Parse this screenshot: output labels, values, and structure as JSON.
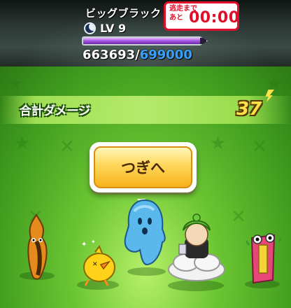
{
  "boss": {
    "name": "ビッグブラック",
    "level_text": "LV  9",
    "hp_current": "663693",
    "hp_sep": "/",
    "hp_max": "699000",
    "hp_fraction": 0.95,
    "icon": "moon-icon"
  },
  "escape_timer": {
    "label_line1": "逃走まで",
    "label_line2": "あと",
    "time": "00:00"
  },
  "battle_result": {
    "damage_label": "合計ダメージ",
    "damage_value": "37"
  },
  "next_button": {
    "label": "つぎへ"
  },
  "party": [
    {
      "icon": "orange-flame-yokai-icon"
    },
    {
      "icon": "yellow-chick-yokai-icon"
    },
    {
      "icon": "blue-ghost-yokai-icon"
    },
    {
      "icon": "green-hair-cloud-yokai-icon"
    },
    {
      "icon": "pink-scroll-yokai-icon"
    }
  ],
  "colors": {
    "timer_red": "#e0102a",
    "hp_purple": "#a455e0",
    "hp_max_blue": "#3aa0ff",
    "damage_yellow": "#ffe14a",
    "button_yellow": "#ffd65a"
  }
}
